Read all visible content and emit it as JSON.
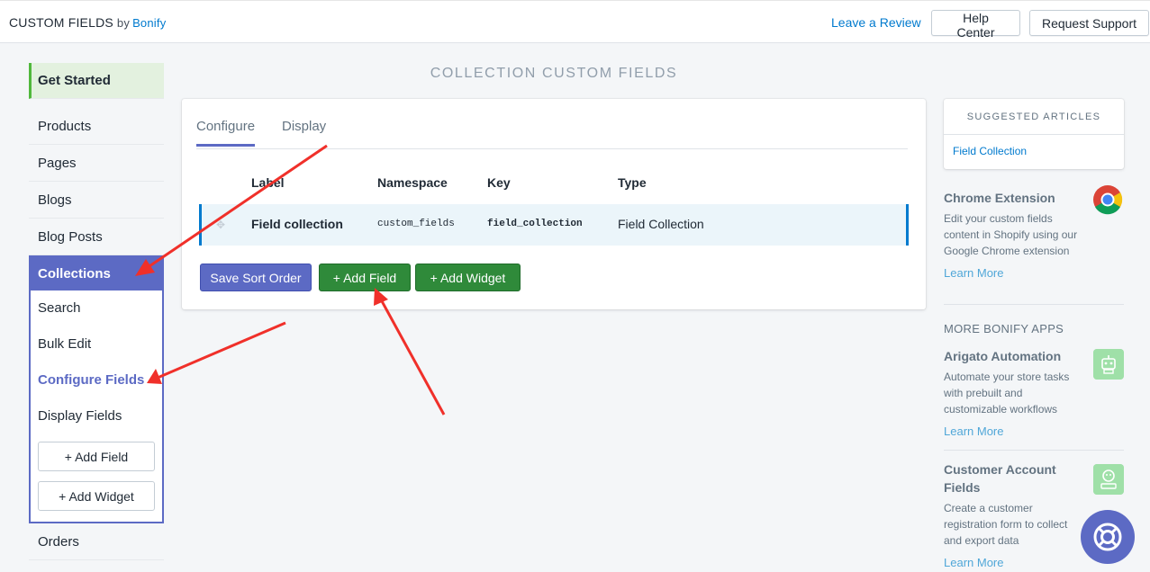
{
  "header": {
    "brand": "CUSTOM FIELDS",
    "by": "by",
    "vendor": "Bonify",
    "review_link": "Leave a Review",
    "help_button": "Help Center",
    "support_button": "Request Support"
  },
  "sidebar": {
    "get_started": "Get Started",
    "items": [
      "Products",
      "Pages",
      "Blogs",
      "Blog Posts"
    ],
    "collections": {
      "heading": "Collections",
      "sub_items": [
        "Search",
        "Bulk Edit",
        "Configure Fields",
        "Display Fields"
      ],
      "active": "Configure Fields",
      "add_field": "+ Add Field",
      "add_widget": "+ Add Widget"
    },
    "orders": "Orders"
  },
  "main": {
    "title": "COLLECTION CUSTOM FIELDS",
    "tabs": [
      "Configure",
      "Display"
    ],
    "selected_tab": "Configure",
    "columns": [
      "Label",
      "Namespace",
      "Key",
      "Type"
    ],
    "rows": [
      {
        "label": "Field collection",
        "namespace": "custom_fields",
        "key": "field_collection",
        "type": "Field Collection"
      }
    ],
    "buttons": {
      "save": "Save Sort Order",
      "add_field": "+ Add Field",
      "add_widget": "+ Add Widget"
    }
  },
  "right": {
    "suggested_title": "SUGGESTED ARTICLES",
    "suggested_link": "Field Collection",
    "chrome": {
      "title": "Chrome Extension",
      "desc": "Edit your custom fields content in Shopify using our Google Chrome extension",
      "link": "Learn More",
      "icon": "chrome-icon"
    },
    "more_heading": "MORE BONIFY APPS",
    "apps": [
      {
        "title": "Arigato Automation",
        "desc": "Automate your store tasks with prebuilt and customizable workflows",
        "link": "Learn More",
        "icon": "robot-icon"
      },
      {
        "title": "Customer Account Fields",
        "desc": "Create a customer registration form to collect and export data",
        "link": "Learn More",
        "icon": "customer-icon"
      }
    ]
  },
  "colors": {
    "accent": "#5c6ac4",
    "primary_green": "#2f8a3a",
    "link": "#007ace",
    "annotation": "#f0302a"
  },
  "help_bubble_icon": "lifebuoy-icon"
}
